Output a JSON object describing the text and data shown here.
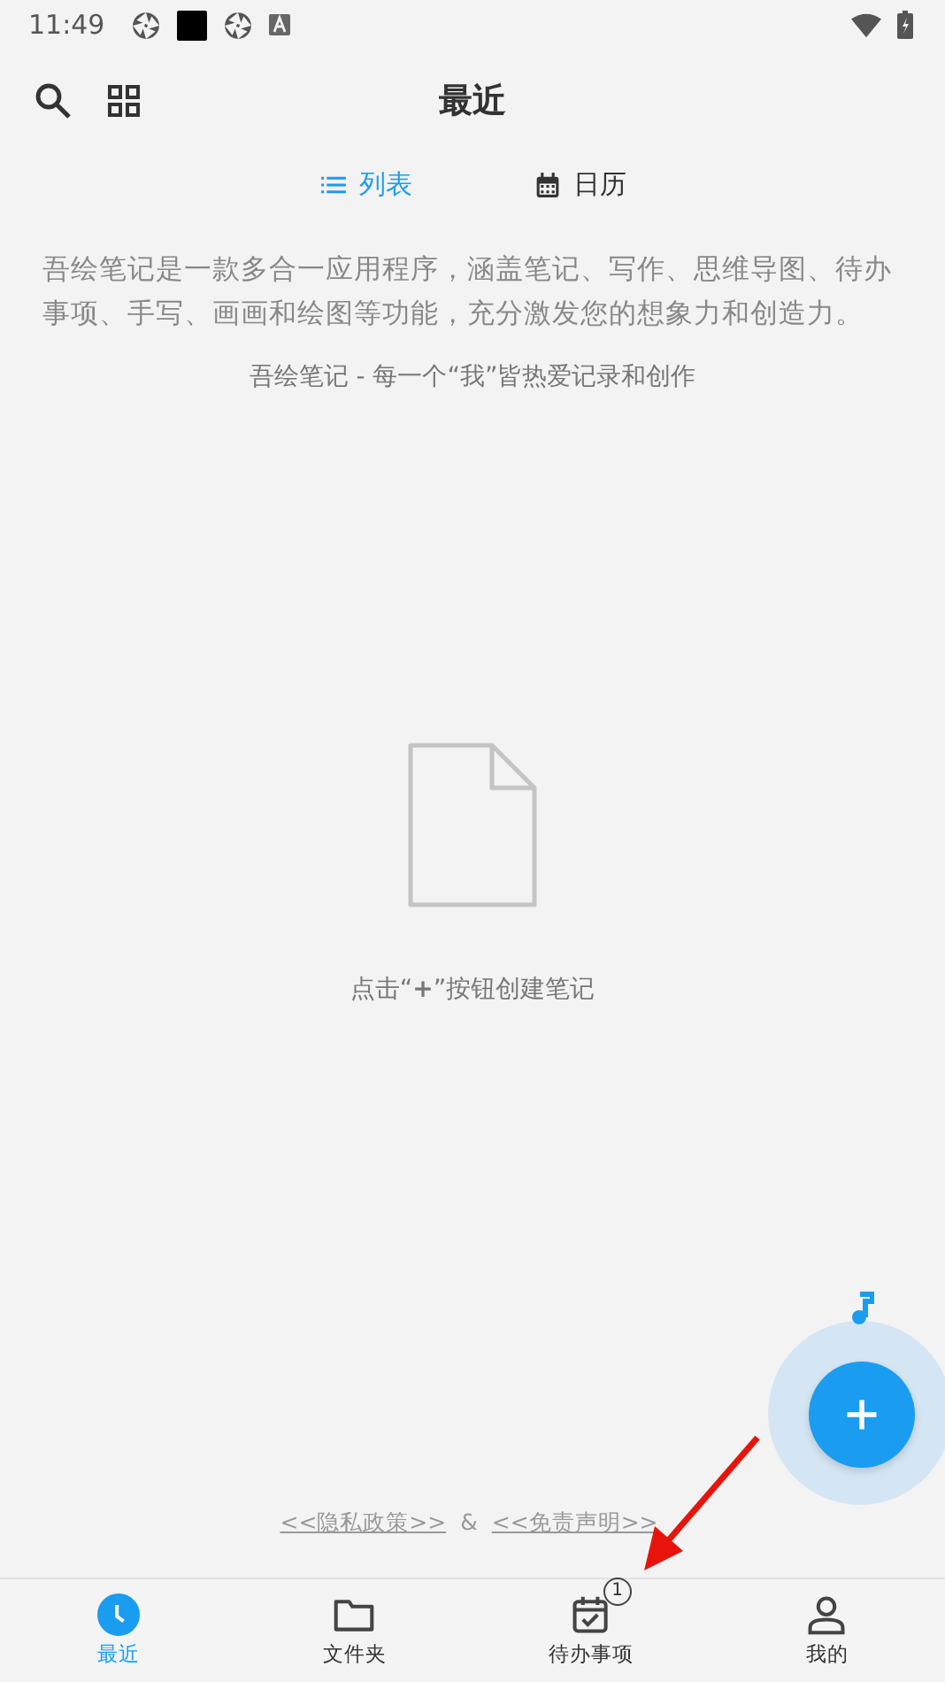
{
  "status_bar": {
    "time": "11:49"
  },
  "header": {
    "title": "最近"
  },
  "view_tabs": [
    {
      "label": "列表",
      "kind": "list",
      "selected": true
    },
    {
      "label": "日历",
      "kind": "calendar",
      "selected": false
    }
  ],
  "intro": {
    "description": "吾绘笔记是一款多合一应用程序，涵盖笔记、写作、思维导图、待办事项、手写、画画和绘图等功能，充分激发您的想象力和创造力。",
    "slogan": "吾绘笔记 - 每一个“我”皆热爱记录和创作"
  },
  "empty_state": {
    "hint": "点击“**+**”按钮创建笔记"
  },
  "footer_links": {
    "privacy": "<<隐私政策>>",
    "separator": "&",
    "disclaimer": "<<免责声明>>"
  },
  "bottom_nav": [
    {
      "label": "最近",
      "kind": "clock",
      "selected": true
    },
    {
      "label": "文件夹",
      "kind": "folder",
      "selected": false
    },
    {
      "label": "待办事项",
      "kind": "todo",
      "selected": false,
      "badge": "1"
    },
    {
      "label": "我的",
      "kind": "person",
      "selected": false
    }
  ]
}
